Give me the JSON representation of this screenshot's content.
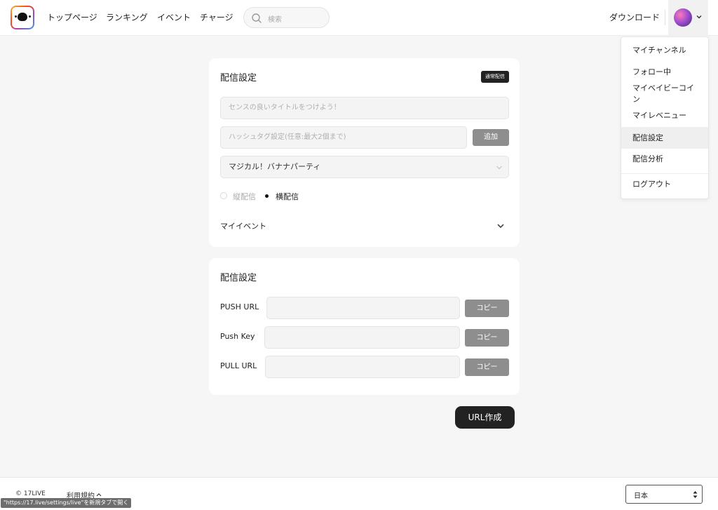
{
  "nav": {
    "links": [
      "トップページ",
      "ランキング",
      "イベント",
      "チャージ"
    ],
    "search_placeholder": "検索",
    "download": "ダウンロード"
  },
  "menu": {
    "items": [
      "マイチャンネル",
      "フォロー中",
      "マイベイビーコイ",
      "ン",
      "マイレベニュー",
      "配信設定",
      "配信分析",
      "ログアウト"
    ],
    "active": "配信設定"
  },
  "stream_settings": {
    "title": "配信設定",
    "badge": "通常配信",
    "title_placeholder": "センスの良いタイトルをつけよう！",
    "hashtag_placeholder": "ハッシュタグ設定(任意:最大2個まで)",
    "add_button": "追加",
    "category_selected": "マジカル！バナナパーティ",
    "orientation": {
      "vertical": "縦配信",
      "horizontal": "横配信",
      "selected": "横配信"
    },
    "my_event": "マイイベント"
  },
  "url_settings": {
    "title": "配信設定",
    "rows": [
      {
        "label": "PUSH URL",
        "button": "コピー"
      },
      {
        "label": "Push Key",
        "button": "コピー"
      },
      {
        "label": "PULL URL",
        "button": "コピー"
      }
    ]
  },
  "create_button": "URL作成",
  "footer": {
    "copyright": "© 17LIVE",
    "terms": "利用規約",
    "language": "日本"
  },
  "status_url": "\"https://17.live/settings/live\"を新規タブで開く",
  "colors": {
    "dark_button": "#222222",
    "gray_button": "#8e8e8e",
    "field_bg": "#f4f4f4"
  }
}
